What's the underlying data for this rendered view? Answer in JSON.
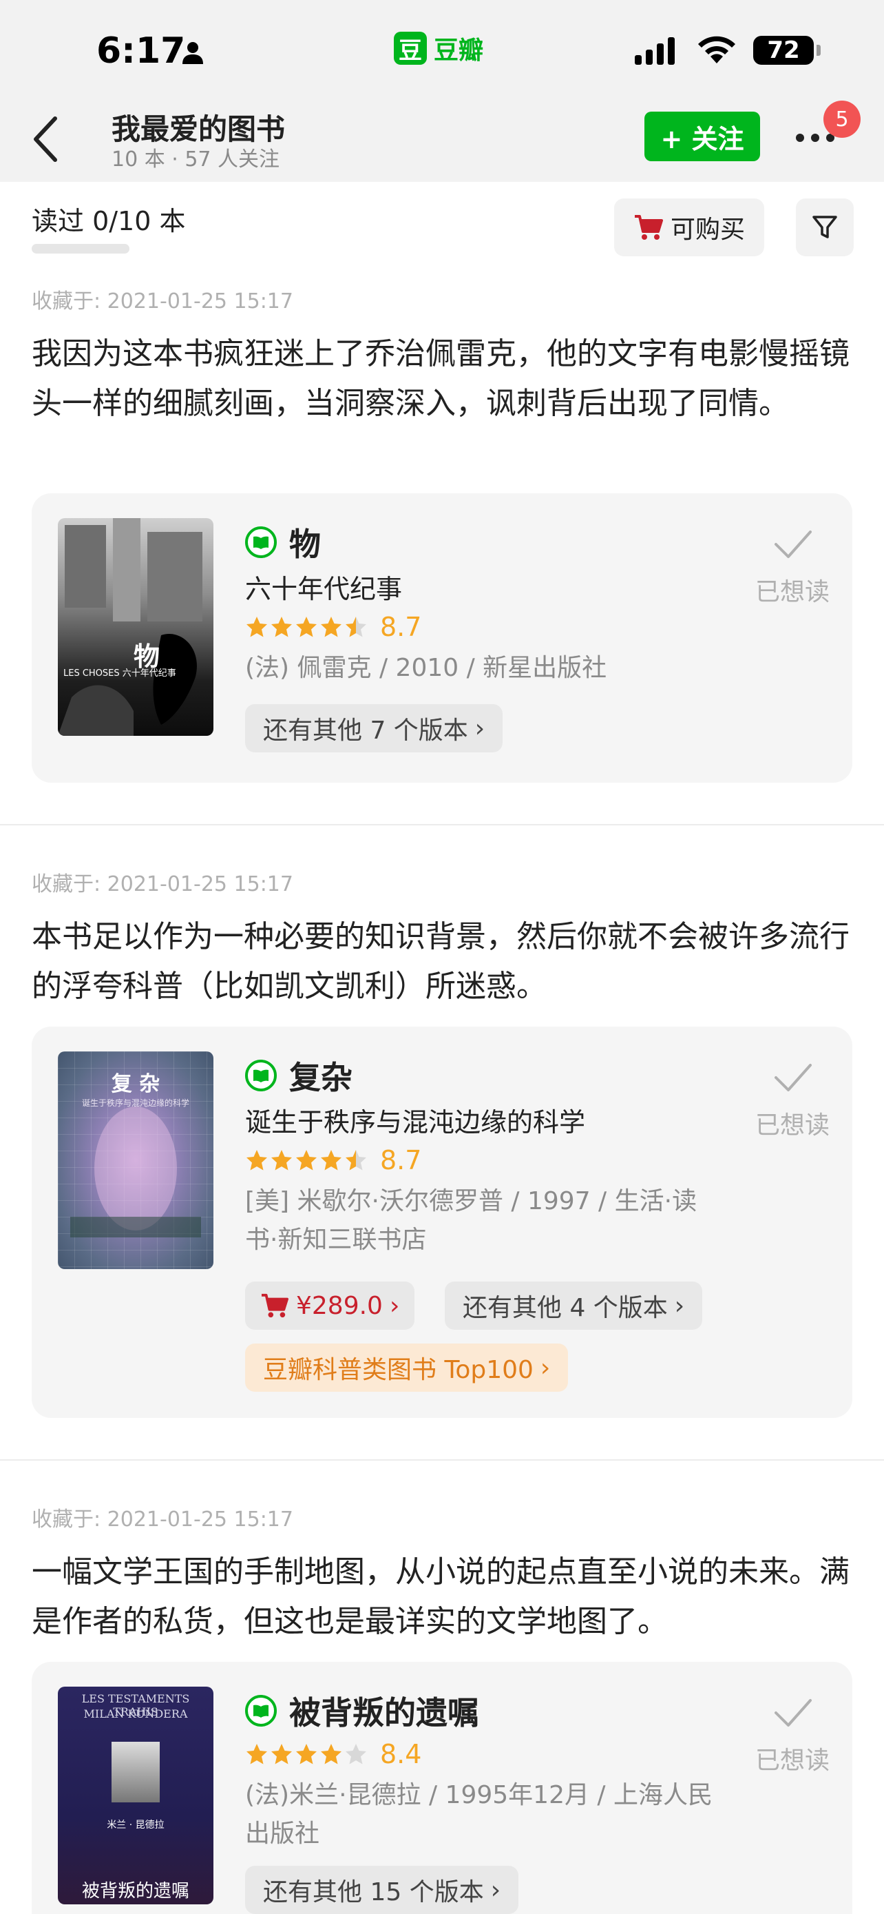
{
  "status_bar": {
    "time": "6:17",
    "app_logo": "豆",
    "app_name": "豆瓣",
    "battery": "72"
  },
  "header": {
    "title": "我最爱的图书",
    "subtitle": "10 本 · 57 人关注",
    "follow_label": "+ 关注",
    "notification_count": "5"
  },
  "toolbar": {
    "read_count": "读过 0/10 本",
    "buy_label": "可购买"
  },
  "entries": [
    {
      "date": "收藏于: 2021-01-25 15:17",
      "comment": "我因为这本书疯狂迷上了乔治佩雷克，他的文字有电影慢摇镜头一样的细腻刻画，当洞察深入，讽刺背后出现了同情。",
      "book": {
        "title": "物",
        "subtitle": "六十年代纪事",
        "rating": 4.5,
        "score": "8.7",
        "meta": "(法) 佩雷克 / 2010 / 新星出版社",
        "versions": "还有其他 7 个版本",
        "wish_label": "已想读",
        "cover_title": "物",
        "cover_sub": "LES CHOSES 六十年代纪事"
      }
    },
    {
      "date": "收藏于: 2021-01-25 15:17",
      "comment": "本书足以作为一种必要的知识背景，然后你就不会被许多流行的浮夸科普（比如凯文凯利）所迷惑。",
      "book": {
        "title": "复杂",
        "subtitle": "诞生于秩序与混沌边缘的科学",
        "rating": 4.5,
        "score": "8.7",
        "meta": "[美] 米歇尔·沃尔德罗普 / 1997 / 生活·读书·新知三联书店",
        "price": "¥289.0",
        "versions": "还有其他 4 个版本",
        "rank": "豆瓣科普类图书 Top100",
        "wish_label": "已想读",
        "cover_title": "复 杂",
        "cover_sub": "诞生于秩序与混沌边缘的科学"
      }
    },
    {
      "date": "收藏于: 2021-01-25 15:17",
      "comment": "一幅文学王国的手制地图，从小说的起点直至小说的未来。满是作者的私货，但这也是最详实的文学地图了。",
      "book": {
        "title": "被背叛的遗嘱",
        "rating": 4,
        "score": "8.4",
        "meta": "(法)米兰·昆德拉 / 1995年12月 / 上海人民出版社",
        "versions": "还有其他 15 个版本",
        "wish_label": "已想读",
        "cover_title_en": "LES TESTAMENTS TRAHIS",
        "cover_author_en": "MILAN KUNDERA",
        "cover_author_cn": "米兰 · 昆德拉",
        "cover_title_cn": "被背叛的遗嘱"
      }
    }
  ],
  "colors": {
    "accent": "#00b51d",
    "star": "#f5a623",
    "price": "#c8202c",
    "rank": "#e07d1a"
  }
}
